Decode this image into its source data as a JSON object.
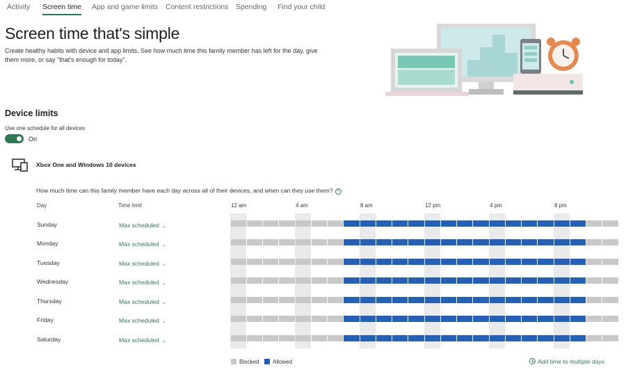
{
  "tabs": [
    {
      "label": "Activity",
      "active": false
    },
    {
      "label": "Screen time",
      "active": true
    },
    {
      "label": "App and game limits",
      "active": false
    },
    {
      "label": "Content restrictions",
      "active": false
    },
    {
      "label": "Spending",
      "active": false
    },
    {
      "label": "Find your child",
      "active": false
    }
  ],
  "header": {
    "title": "Screen time that's simple",
    "description": "Create healthy habits with device and app limits. See how much time this family member has left for the day, give them more, or say \"that's enough for today\"."
  },
  "device_limits": {
    "title": "Device limits",
    "schedule_label": "Use one schedule for all devices",
    "toggle_state": "On",
    "device_name": "Xbox One and Windows 10 devices",
    "question": "How much time can this family member have each day across all of their devices, and when can they use them?"
  },
  "table": {
    "col_day": "Day",
    "col_time_limit": "Time limit",
    "hour_labels": [
      "12 am",
      "4 am",
      "8 am",
      "12 pm",
      "4 pm",
      "8 pm"
    ],
    "days": [
      {
        "day": "Sunday",
        "limit": "Max scheduled"
      },
      {
        "day": "Monday",
        "limit": "Max scheduled"
      },
      {
        "day": "Tuesday",
        "limit": "Max scheduled"
      },
      {
        "day": "Wednesday",
        "limit": "Max scheduled"
      },
      {
        "day": "Thursday",
        "limit": "Max scheduled"
      },
      {
        "day": "Friday",
        "limit": "Max scheduled"
      },
      {
        "day": "Saturday",
        "limit": "Max scheduled"
      }
    ],
    "allowed_start_hour": 7,
    "allowed_end_hour": 22,
    "hours_per_day": 24
  },
  "legend": {
    "blocked": "Blocked",
    "allowed": "Allowed"
  },
  "actions": {
    "add_time": "Add time to multiple days"
  },
  "colors": {
    "accent": "#2d7a52",
    "allowed": "#2360b7",
    "blocked": "#c8c8c8"
  },
  "icons": {
    "device": "devices-icon",
    "help": "help-circle-icon",
    "chevron": "chevron-down-icon",
    "clock": "clock-icon"
  }
}
